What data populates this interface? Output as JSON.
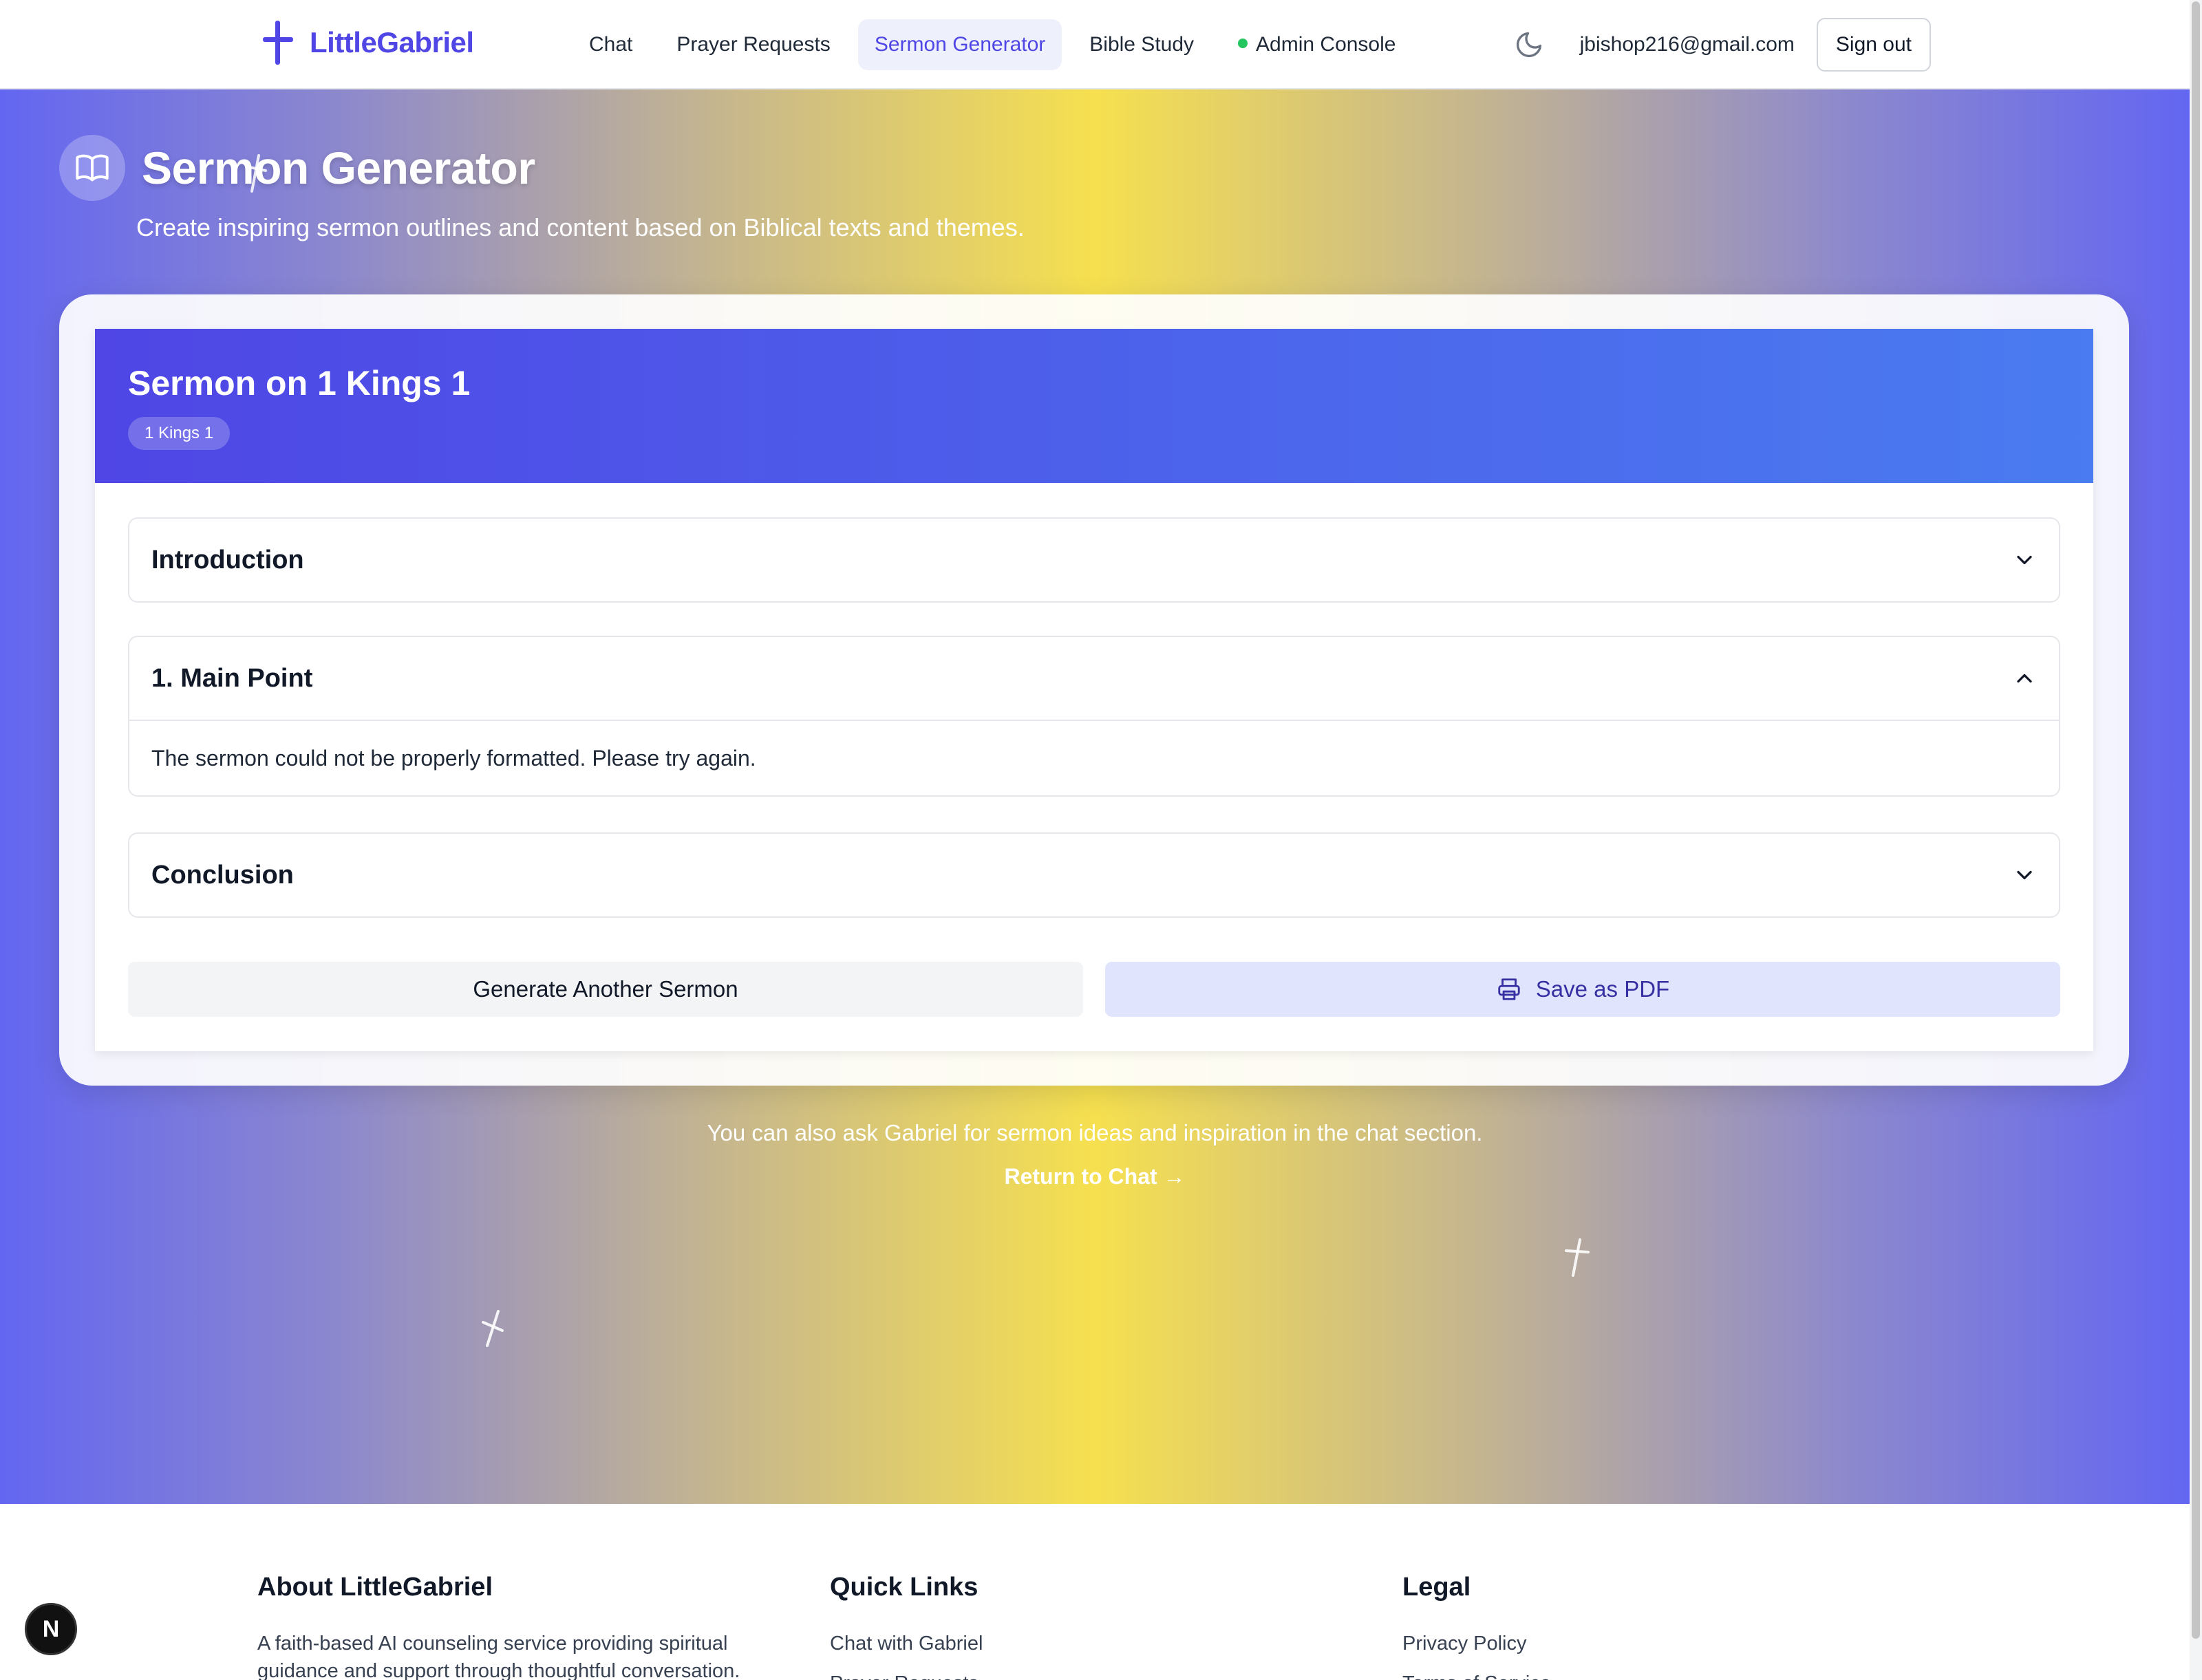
{
  "nav": {
    "brand": "LittleGabriel",
    "links": [
      "Chat",
      "Prayer Requests",
      "Sermon Generator",
      "Bible Study",
      "Admin Console"
    ],
    "active": "Sermon Generator",
    "user_email": "jbishop216@gmail.com",
    "signout_label": "Sign out"
  },
  "hero": {
    "title": "Sermon Generator",
    "subtitle": "Create inspiring sermon outlines and content based on Biblical texts and themes."
  },
  "sermon": {
    "title": "Sermon on 1 Kings 1",
    "passage": "1 Kings 1",
    "sections": [
      {
        "title": "Introduction",
        "expanded": false
      },
      {
        "title": "1. Main Point",
        "expanded": true,
        "body": "The sermon could not be properly formatted. Please try again."
      },
      {
        "title": "Conclusion",
        "expanded": false
      }
    ],
    "generate_label": "Generate Another Sermon",
    "pdf_label": "Save as PDF"
  },
  "below": {
    "text": "You can also ask Gabriel for sermon ideas and inspiration in the chat section.",
    "link": "Return to Chat →"
  },
  "footer": {
    "about_title": "About LittleGabriel",
    "about_text": "A faith-based AI counseling service providing spiritual guidance and support through thoughtful conversation.",
    "quick_title": "Quick Links",
    "quick_links": [
      "Chat with Gabriel",
      "Prayer Requests"
    ],
    "legal_title": "Legal",
    "legal_links": [
      "Privacy Policy",
      "Terms of Service"
    ]
  },
  "dev_badge": "N",
  "colors": {
    "brand": "#4f46e5",
    "gradient_edge": "#6366f1",
    "gradient_center": "#f6e04f",
    "status_dot": "#22c55e"
  },
  "icons": [
    "cross-logo-icon",
    "moon-icon",
    "book-icon",
    "chevron-down-icon",
    "chevron-up-icon",
    "printer-icon",
    "cross-decoration-icon"
  ]
}
